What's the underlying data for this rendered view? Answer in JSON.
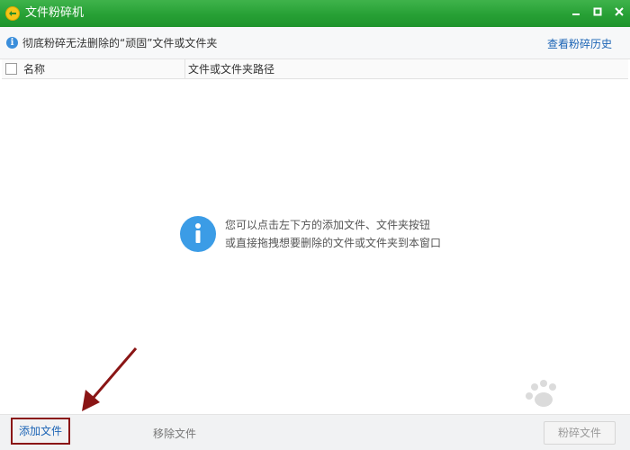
{
  "window": {
    "title": "文件粉碎机",
    "logo_icon": "shield-icon",
    "minimize_icon": "minimize-icon",
    "maximize_icon": "maximize-icon",
    "close_icon": "close-icon",
    "titlebar_color": "#27a035"
  },
  "infobar": {
    "icon": "info-icon",
    "text": "彻底粉碎无法删除的“顽固”文件或文件夹",
    "history_link": "查看粉碎历史"
  },
  "table": {
    "columns": [
      "名称",
      "文件或文件夹路径"
    ],
    "rows": []
  },
  "empty_hint": {
    "icon": "info-icon",
    "line1": "您可以点击左下方的添加文件、文件夹按钮",
    "line2": "或直接拖拽想要删除的文件或文件夹到本窗口"
  },
  "bottombar": {
    "add_file": "添加文件",
    "remove_file": "移除文件",
    "shred_file": "粉碎文件"
  },
  "annotation": {
    "arrow_color": "#8a1515"
  }
}
